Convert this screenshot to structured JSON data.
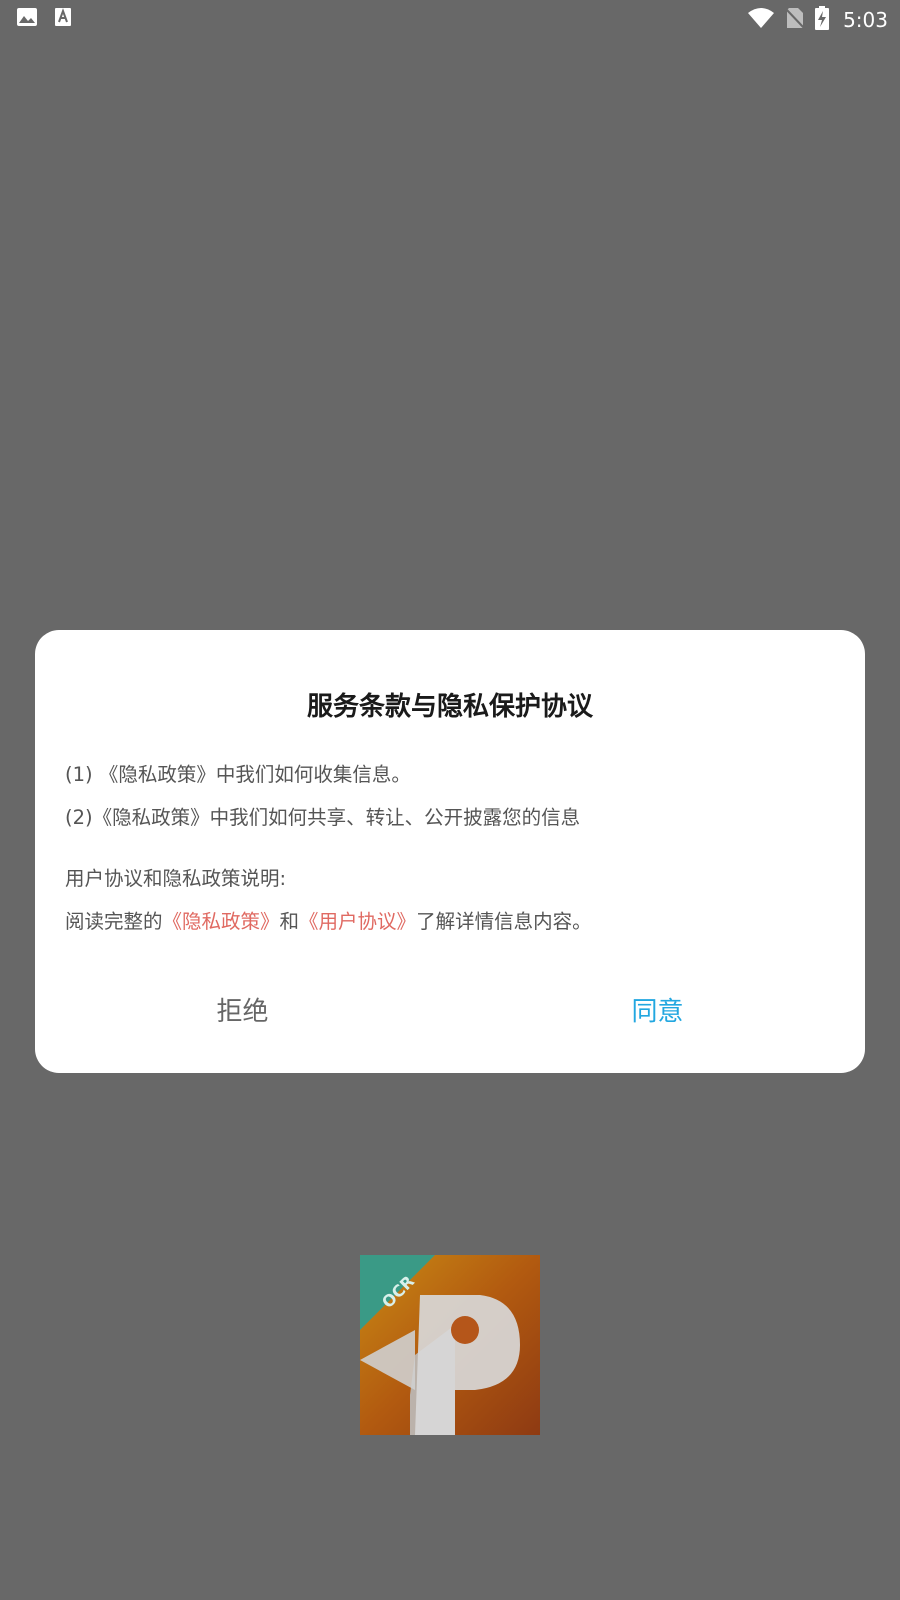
{
  "status_bar": {
    "time": "5:03",
    "icons": [
      "image-icon",
      "font-icon",
      "wifi-icon",
      "no-sim-icon",
      "battery-charging-icon"
    ]
  },
  "dialog": {
    "title": "服务条款与隐私保护协议",
    "line1": "(1) 《隐私政策》中我们如何收集信息。",
    "line2": "(2)《隐私政策》中我们如何共享、转让、公开披露您的信息",
    "line3": "用户协议和隐私政策说明:",
    "line4": {
      "prefix": "阅读完整的",
      "privacy_link": "《隐私政策》",
      "and": "和",
      "user_link": "《用户协议》",
      "suffix": "了解详情信息内容。"
    },
    "reject_label": "拒绝",
    "agree_label": "同意"
  },
  "logo": {
    "badge_text": "OCR"
  },
  "colors": {
    "overlay": "#686868",
    "link": "#e06a62",
    "agree": "#22a7e0",
    "reject": "#666666"
  }
}
